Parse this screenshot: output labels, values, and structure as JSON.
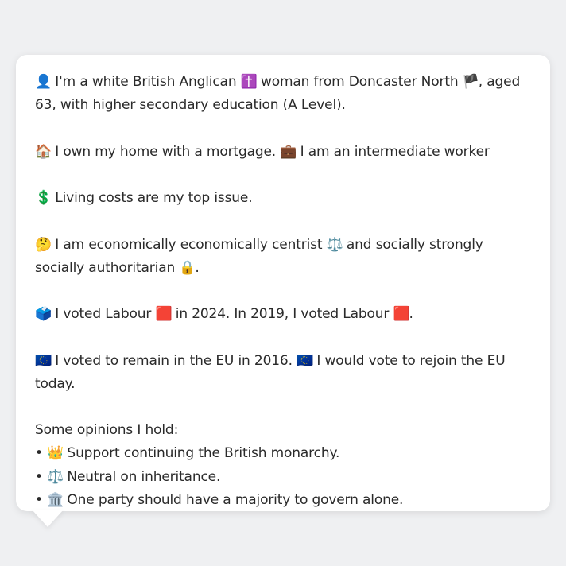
{
  "profile": {
    "identity": {
      "icon": "👤",
      "text_a": "I'm a white British Anglican",
      "religion_icon": "✝️",
      "text_b": "woman from Doncaster North",
      "flag_icon": "🏴",
      "text_c": ", aged 63, with higher secondary education (A Level)."
    },
    "housing": {
      "icon": "🏠",
      "text_a": "I own my home with a mortgage.",
      "work_icon": "💼",
      "text_b": "I am an intermediate worker"
    },
    "issue": {
      "icon": "💲",
      "text": "Living costs are my top issue."
    },
    "ideology": {
      "icon": "🤔",
      "text_a": "I am economically economically centrist",
      "econ_icon": "⚖️",
      "text_b": "and socially strongly socially authoritarian",
      "social_icon": "🔒",
      "text_c": "."
    },
    "votes": {
      "icon": "🗳️",
      "text_a": "I voted Labour",
      "party_icon_1": "🟥",
      "text_b": "in 2024. In 2019, I voted Labour",
      "party_icon_2": "🟥",
      "text_c": "."
    },
    "eu": {
      "icon": "🇪🇺",
      "text_a": "I voted to remain in the EU in 2016.",
      "icon_2": "🇪🇺",
      "text_b": "I would vote to rejoin the EU today."
    },
    "opinions": {
      "heading": "Some opinions I hold:",
      "items": [
        {
          "bullet": "•",
          "icon": "👑",
          "text": "Support continuing the British monarchy."
        },
        {
          "bullet": "•",
          "icon": "⚖️",
          "text": "Neutral on inheritance."
        },
        {
          "bullet": "•",
          "icon": "🏛️",
          "text": "One party should have a majority to govern alone."
        }
      ]
    }
  },
  "colors": {
    "background": "#eff0f2",
    "card": "#ffffff",
    "text": "#2a2a2a"
  }
}
